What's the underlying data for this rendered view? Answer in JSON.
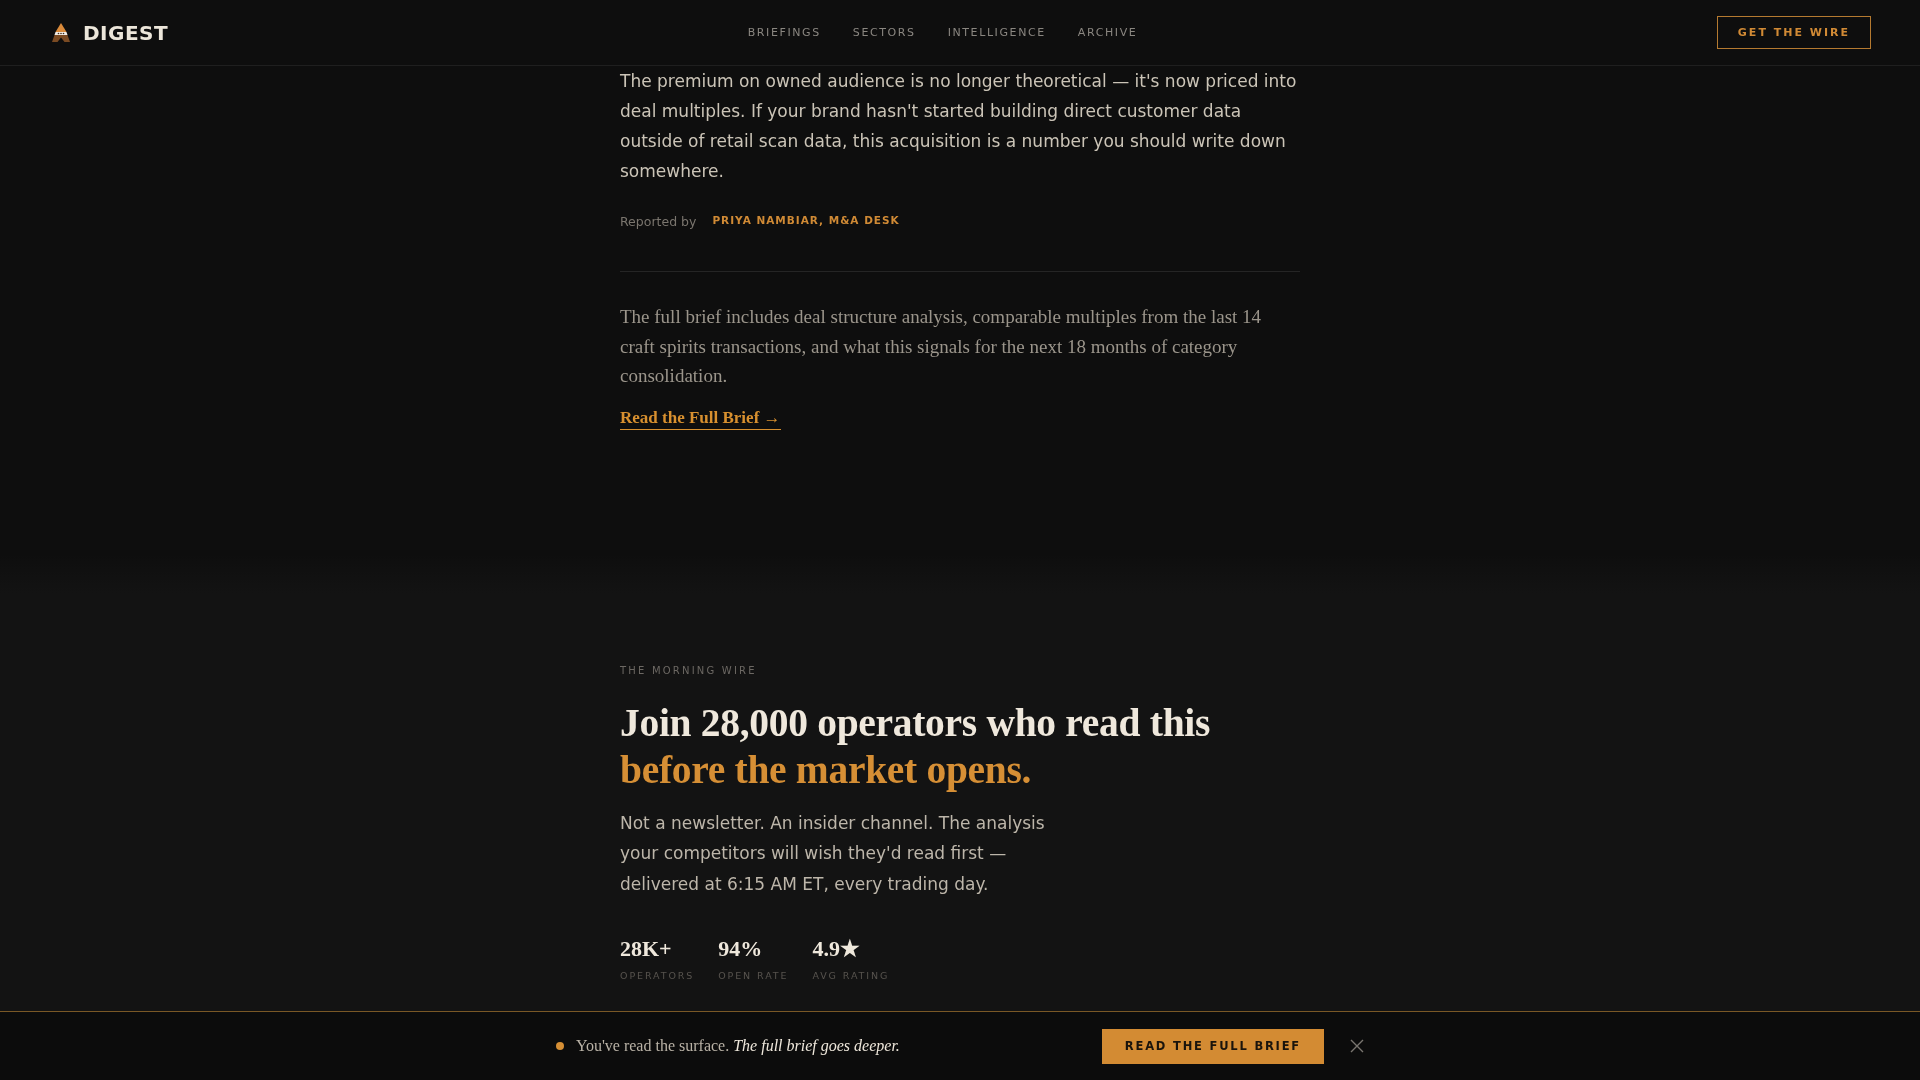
{
  "header": {
    "brand": "DIGEST",
    "nav": [
      {
        "label": "BRIEFINGS"
      },
      {
        "label": "SECTORS"
      },
      {
        "label": "INTELLIGENCE"
      },
      {
        "label": "ARCHIVE"
      }
    ],
    "cta": "GET THE WIRE"
  },
  "article": {
    "body": "The premium on owned audience is no longer theoretical — it's now priced into deal multiples. If your brand hasn't started building direct customer data outside of retail scan data, this acquisition is a number you should write down somewhere.",
    "byline_label": "Reported by",
    "byline": "PRIYA NAMBIAR, M&A DESK",
    "teaser": "The full brief includes deal structure analysis, comparable multiples from the last 14 craft spirits transactions, and what this signals for the next 18 months of category consolidation.",
    "link": "Read the Full Brief →"
  },
  "signup": {
    "eyebrow": "THE MORNING WIRE",
    "title": "Join 28,000 operators who read this",
    "title_highlight": "before the market opens.",
    "lead": "Not a newsletter. An insider channel. The analysis your competitors will wish they'd read first — delivered at 6:15 AM ET, every trading day.",
    "stats": [
      {
        "value": "28K+",
        "label": "OPERATORS"
      },
      {
        "value": "94%",
        "label": "OPEN RATE"
      },
      {
        "value": "4.9★",
        "label": "AVG RATING"
      }
    ]
  },
  "sticky_bar": {
    "message": "You've read the surface. *The full brief goes deeper.*",
    "button": "READ THE FULL BRIEF"
  }
}
